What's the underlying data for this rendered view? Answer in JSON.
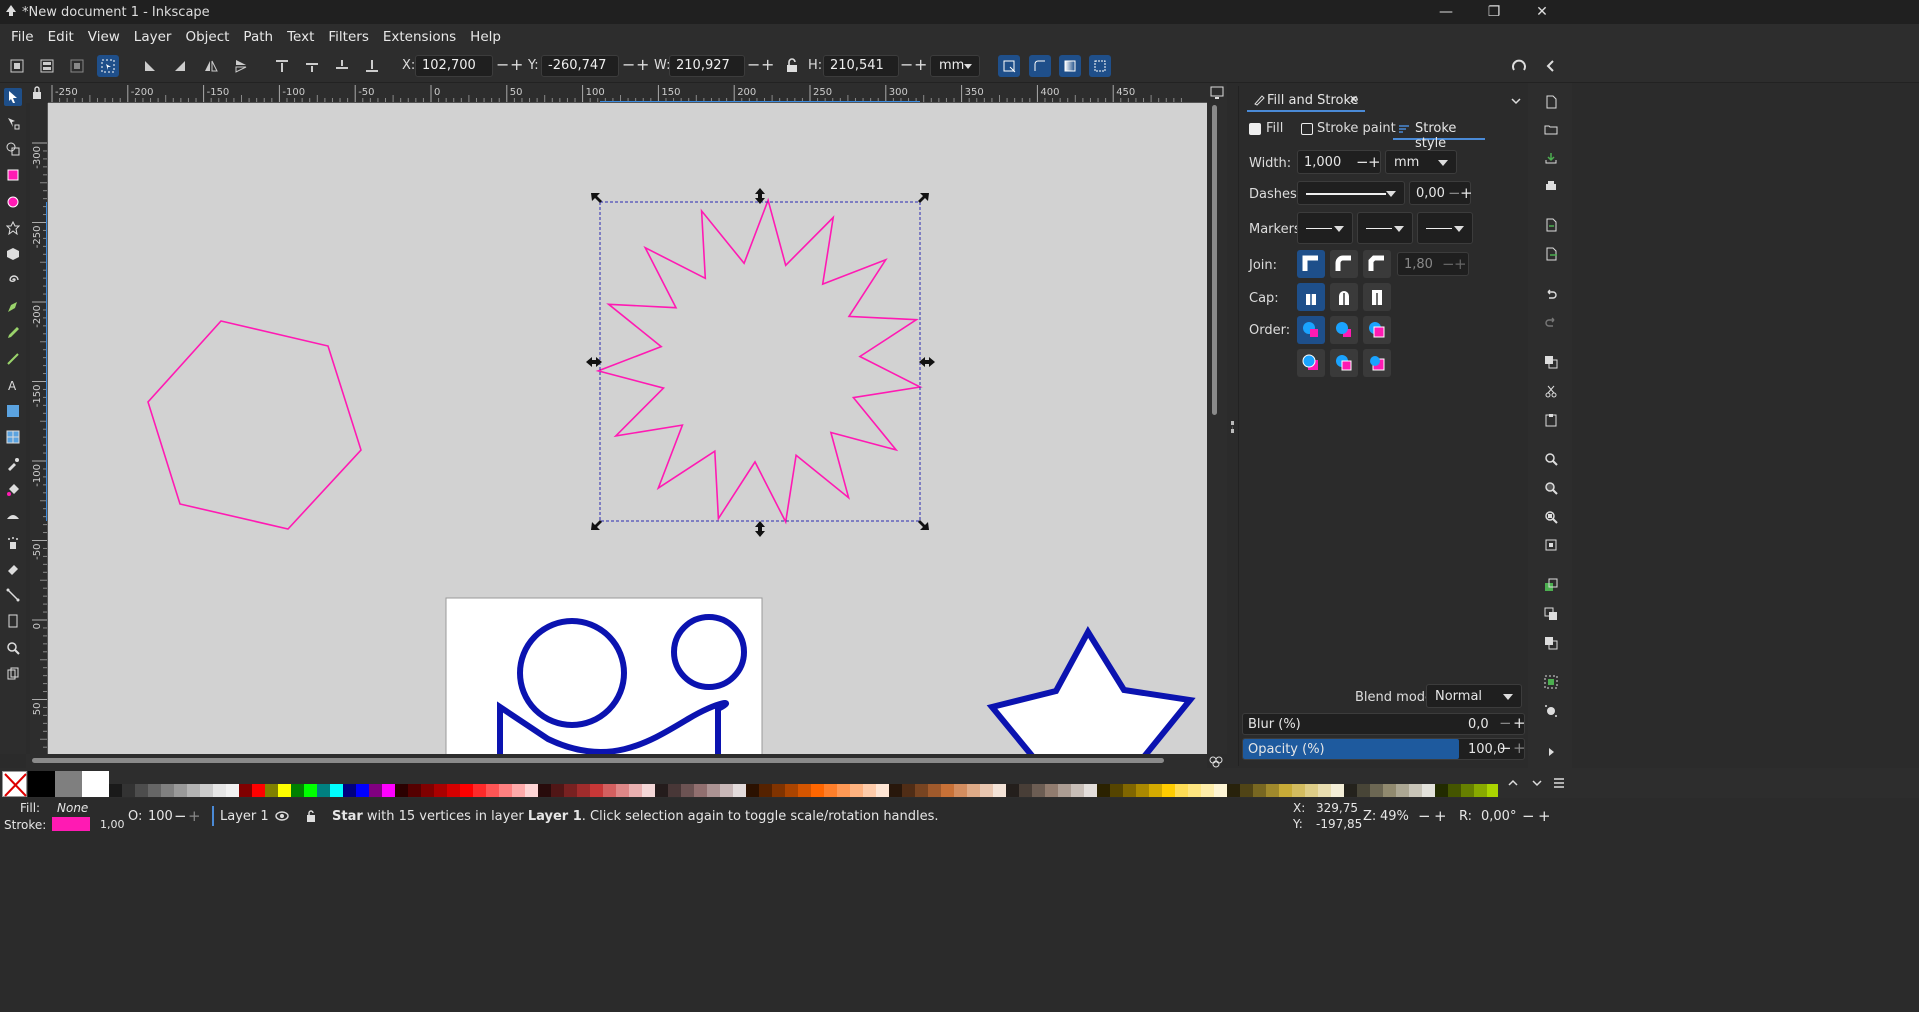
{
  "window": {
    "title": "*New document 1 - Inkscape",
    "min_label": "—",
    "max_label": "❐",
    "close_label": "✕"
  },
  "menu": [
    "File",
    "Edit",
    "View",
    "Layer",
    "Object",
    "Path",
    "Text",
    "Filters",
    "Extensions",
    "Help"
  ],
  "toolbar": {
    "x_label": "X:",
    "x_value": "102,700",
    "y_label": "Y:",
    "y_value": "-260,747",
    "w_label": "W:",
    "w_value": "210,927",
    "h_label": "H:",
    "h_value": "210,541",
    "unit": "mm",
    "minus": "−",
    "plus": "+"
  },
  "ruler": {
    "h_ticks": [
      "-250",
      "-200",
      "-150",
      "-100",
      "-50",
      "0",
      "50",
      "100",
      "150",
      "200",
      "250",
      "300",
      "350",
      "400",
      "450"
    ],
    "v_ticks": [
      "-300",
      "-250",
      "-200",
      "-150",
      "-100",
      "-50",
      "0",
      "50"
    ]
  },
  "panel": {
    "title": "Fill and Stroke",
    "close": "✕",
    "tabs": [
      "Fill",
      "Stroke paint",
      "Stroke style"
    ],
    "width_label": "Width:",
    "width_value": "1,000",
    "width_unit": "mm",
    "dashes_label": "Dashes:",
    "dashes_value": "0,00",
    "markers_label": "Markers:",
    "join_label": "Join:",
    "miter_value": "1,80",
    "cap_label": "Cap:",
    "order_label": "Order:",
    "blend_label": "Blend mode:",
    "blend_value": "Normal",
    "blur_label": "Blur (%)",
    "blur_value": "0,0",
    "opacity_label": "Opacity (%)",
    "opacity_value": "100,0",
    "opacity_level": 1.0
  },
  "status": {
    "fill_label": "Fill:",
    "fill_value": "None",
    "stroke_label": "Stroke:",
    "stroke_width": "1,00",
    "stroke_color": "#ff1ab3",
    "opacity_label": "O:",
    "opacity_value": "100",
    "layer": "Layer 1",
    "message_bold": "Star",
    "message_rest": " with 15 vertices in layer ",
    "message_layer": "Layer 1",
    "message_tail": ". Click selection again to toggle scale/rotation handles.",
    "x_label": "X:",
    "x_coord": "329,75",
    "y_label": "Y:",
    "y_coord": "-197,85",
    "z_label": "Z:",
    "zoom": "49%",
    "r_label": "R:",
    "rotation": "0,00°"
  },
  "colors": {
    "magenta": "#ff1ab3",
    "blue_shape": "#0b13b0",
    "accent": "#1e4f8a"
  },
  "palette": [
    "#000000",
    "#7f7f7f",
    "#ffffff",
    "#1a1a1a",
    "#333333",
    "#4d4d4d",
    "#666666",
    "#808080",
    "#999999",
    "#b3b3b3",
    "#cccccc",
    "#e6e6e6",
    "#f2f2f2",
    "#800000",
    "#ff0000",
    "#808000",
    "#ffff00",
    "#008000",
    "#00ff00",
    "#008080",
    "#00ffff",
    "#000080",
    "#0000ff",
    "#800080",
    "#ff00ff",
    "#2b0000",
    "#550000",
    "#800000",
    "#aa0000",
    "#d40000",
    "#ff0000",
    "#ff2a2a",
    "#ff5555",
    "#ff8080",
    "#ffaaaa",
    "#ffd5d5",
    "#280b0b",
    "#501616",
    "#782121",
    "#a02c2c",
    "#c83737",
    "#d35f5f",
    "#de8787",
    "#e9afaf",
    "#f4d7d7",
    "#241c1c",
    "#483737",
    "#6c5353",
    "#916f6f",
    "#ac9393",
    "#c8b7b7",
    "#e3dbdb",
    "#2b1100",
    "#552200",
    "#803300",
    "#aa4400",
    "#d45500",
    "#ff6600",
    "#ff7f2a",
    "#ff9955",
    "#ffb380",
    "#ffccaa",
    "#ffe6d5",
    "#28170b",
    "#502d16",
    "#784421",
    "#a05a2c",
    "#c87137",
    "#d38d5f",
    "#deaa87",
    "#e9c6af",
    "#f4e3d7",
    "#241f1c",
    "#483e37",
    "#6c5d53",
    "#917c6f",
    "#ac9d93",
    "#c8beb7",
    "#e3dedb",
    "#2b2200",
    "#554400",
    "#806600",
    "#aa8800",
    "#d4aa00",
    "#ffcc00",
    "#ffdd55",
    "#ffe680",
    "#ffeeaa",
    "#fff6d5",
    "#28220b",
    "#504416",
    "#786721",
    "#a0892c",
    "#c8ab37",
    "#d3bc5f",
    "#decd87",
    "#e9ddaf",
    "#f4eed7",
    "#24221c",
    "#484537",
    "#6c6753",
    "#918a6f",
    "#aca793",
    "#c8c4b7",
    "#e3e2db",
    "#222b00",
    "#445500",
    "#668000",
    "#88aa00",
    "#aad400"
  ]
}
